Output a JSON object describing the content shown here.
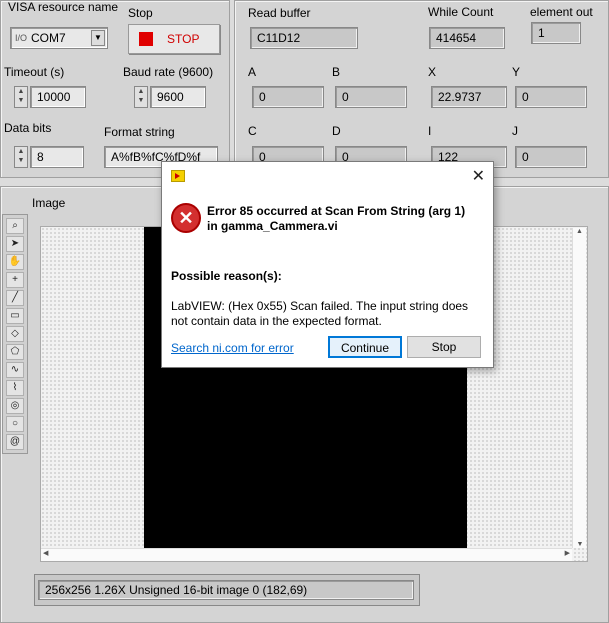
{
  "visa": {
    "label": "VISA resource name",
    "value": "COM7",
    "prefix_icon": "visa-io-icon"
  },
  "stop": {
    "label": "Stop",
    "button_label": "STOP"
  },
  "timeout": {
    "label": "Timeout (s)",
    "value": "10000"
  },
  "baud": {
    "label": "Baud rate (9600)",
    "value": "9600"
  },
  "databits": {
    "label": "Data bits",
    "value": "8"
  },
  "format": {
    "label": "Format string",
    "value": "A%fB%fC%fD%f"
  },
  "read_buffer": {
    "label": "Read buffer",
    "value": "C11D12"
  },
  "while_count": {
    "label": "While Count",
    "value": "414654"
  },
  "element_out": {
    "label": "element out",
    "value": "1"
  },
  "a": {
    "label": "A",
    "value": "0"
  },
  "b": {
    "label": "B",
    "value": "0"
  },
  "x": {
    "label": "X",
    "value": "22.9737"
  },
  "y": {
    "label": "Y",
    "value": "0"
  },
  "c": {
    "label": "C",
    "value": "0"
  },
  "d": {
    "label": "D",
    "value": "0"
  },
  "i": {
    "label": "I",
    "value": "122"
  },
  "j": {
    "label": "J",
    "value": "0"
  },
  "image": {
    "label": "Image",
    "status": "256x256 1.26X Unsigned 16-bit image 0    (182,69)"
  },
  "tools": [
    "zoom-icon",
    "pointer-icon",
    "pan-icon",
    "crosshair-icon",
    "line-icon",
    "rectangle-icon",
    "rotated-rect-icon",
    "polygon-icon",
    "freehand-icon",
    "broken-line-icon",
    "annulus-icon",
    "oval-icon",
    "spiral-icon"
  ],
  "dialog": {
    "title_icon": "labview-icon",
    "error_title": "Error 85 occurred at Scan From String (arg 1) in gamma_Cammera.vi",
    "reason_heading": "Possible reason(s):",
    "reason_text": "LabVIEW: (Hex 0x55) Scan failed. The input string does not contain data in the expected format.",
    "search_link": "Search ni.com for error",
    "continue_label": "Continue",
    "stop_label": "Stop"
  },
  "colors": {
    "accent": "#0066cc",
    "stop_red": "#e00000",
    "error_red": "#d32f2f"
  }
}
